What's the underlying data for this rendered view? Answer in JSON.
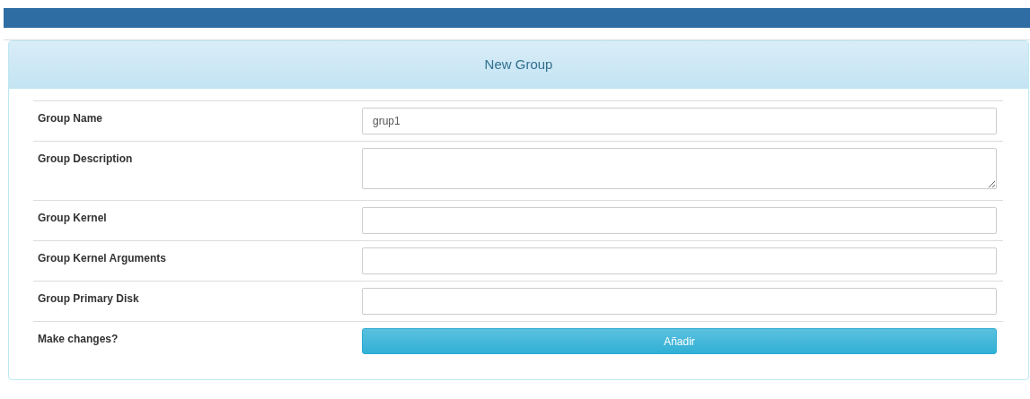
{
  "panel": {
    "title": "New Group"
  },
  "rows": [
    {
      "label": "Group Name",
      "kind": "text",
      "value": "grup1"
    },
    {
      "label": "Group Description",
      "kind": "textarea",
      "value": ""
    },
    {
      "label": "Group Kernel",
      "kind": "text",
      "value": ""
    },
    {
      "label": "Group Kernel Arguments",
      "kind": "text",
      "value": ""
    },
    {
      "label": "Group Primary Disk",
      "kind": "text",
      "value": ""
    },
    {
      "label": "Make changes?",
      "kind": "button",
      "value": "Añadir"
    }
  ]
}
